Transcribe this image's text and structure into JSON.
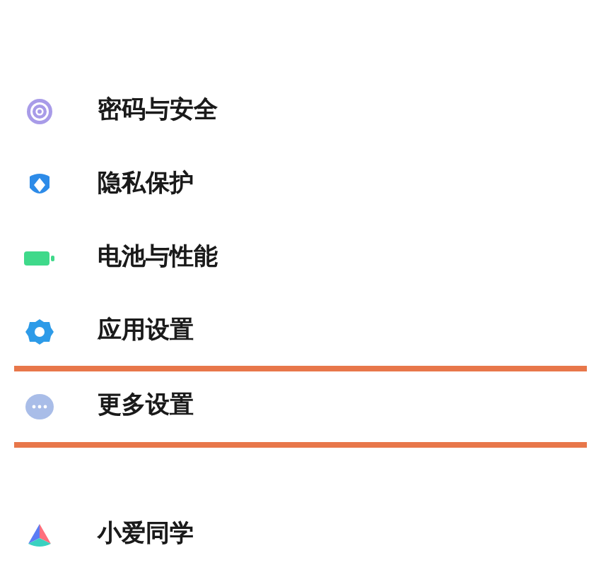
{
  "groups": [
    {
      "items": [
        {
          "kind": "password",
          "label": "密码与安全",
          "highlighted": false
        },
        {
          "kind": "privacy",
          "label": "隐私保护",
          "highlighted": false
        },
        {
          "kind": "battery",
          "label": "电池与性能",
          "highlighted": false
        },
        {
          "kind": "apps",
          "label": "应用设置",
          "highlighted": false
        },
        {
          "kind": "more",
          "label": "更多设置",
          "highlighted": true
        }
      ]
    },
    {
      "items": [
        {
          "kind": "assistant",
          "label": "小爱同学",
          "highlighted": false
        }
      ]
    }
  ]
}
